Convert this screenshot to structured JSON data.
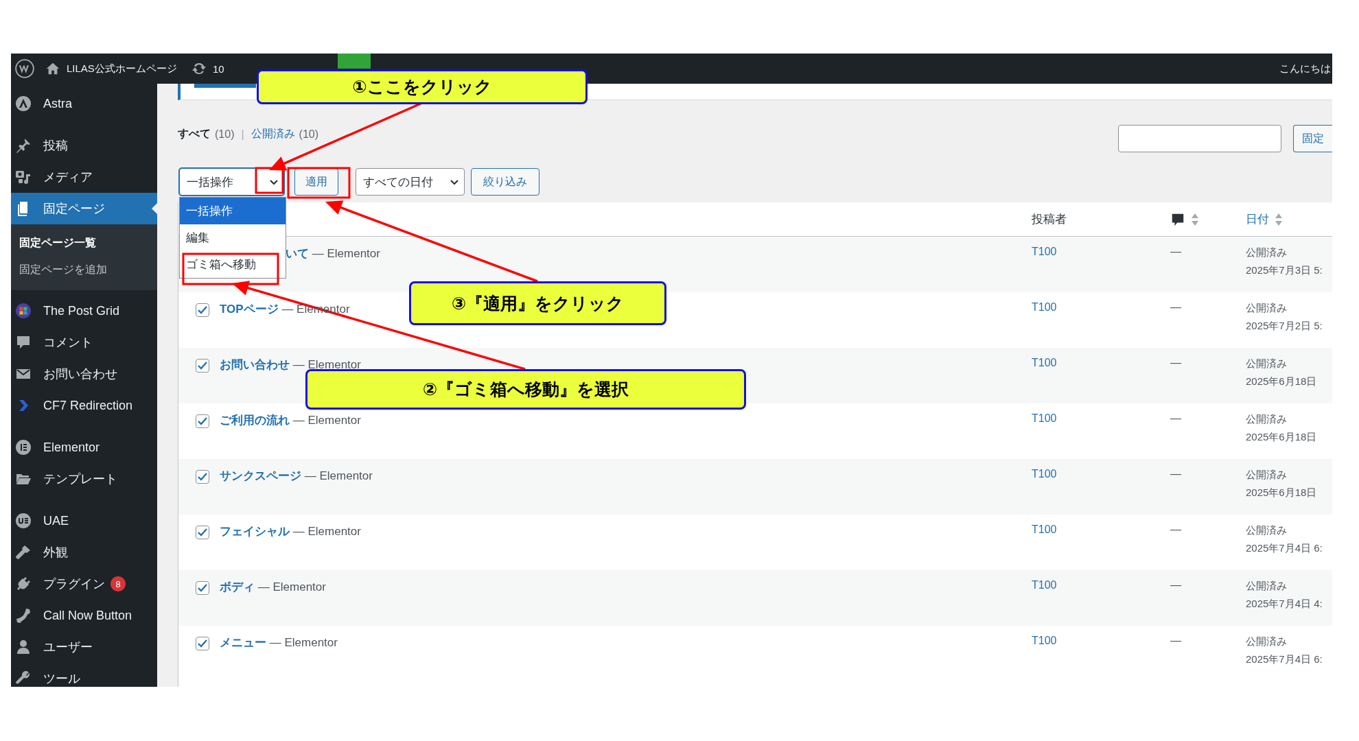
{
  "admin_bar": {
    "site_name": "LILAS公式ホームページ",
    "updates": "10",
    "greeting": "こんにちは"
  },
  "sidebar": {
    "groups": [
      [
        {
          "label": "Astra",
          "kind": "astra",
          "selected": false
        }
      ],
      [
        {
          "label": "投稿",
          "kind": "pin",
          "selected": false
        },
        {
          "label": "メディア",
          "kind": "media",
          "selected": false
        },
        {
          "label": "固定ページ",
          "kind": "pages",
          "selected": true,
          "children": [
            {
              "label": "固定ページ一覧",
              "selected": true
            },
            {
              "label": "固定ページを追加",
              "selected": false
            }
          ]
        },
        {
          "label": "The Post Grid",
          "kind": "grid",
          "selected": false
        },
        {
          "label": "コメント",
          "kind": "comment",
          "selected": false
        },
        {
          "label": "お問い合わせ",
          "kind": "mail",
          "selected": false
        },
        {
          "label": "CF7 Redirection",
          "kind": "chevron",
          "selected": false
        }
      ],
      [
        {
          "label": "Elementor",
          "kind": "elementor",
          "selected": false
        },
        {
          "label": "テンプレート",
          "kind": "folder",
          "selected": false
        }
      ],
      [
        {
          "label": "UAE",
          "kind": "uae",
          "selected": false
        },
        {
          "label": "外観",
          "kind": "brush",
          "selected": false
        },
        {
          "label": "プラグイン",
          "kind": "plug",
          "selected": false,
          "badge": "8"
        },
        {
          "label": "Call Now Button",
          "kind": "phone",
          "selected": false
        },
        {
          "label": "ユーザー",
          "kind": "user",
          "selected": false
        },
        {
          "label": "ツール",
          "kind": "wrench",
          "selected": false
        }
      ]
    ]
  },
  "views": {
    "separator": "|",
    "items": [
      {
        "label": "すべて",
        "count": "(10)",
        "selected": true
      },
      {
        "label": "公開済み",
        "count": "(10)",
        "selected": false
      }
    ]
  },
  "search": {
    "button": "固定"
  },
  "bulk_actions": {
    "value": "一括操作",
    "expanded": true,
    "options": [
      {
        "label": "一括操作",
        "selected": true
      },
      {
        "label": "編集",
        "selected": false
      },
      {
        "label": "ゴミ箱へ移動",
        "selected": false
      }
    ]
  },
  "apply_button": "適用",
  "date_filter": "すべての日付",
  "filter_button": "絞り込み",
  "table": {
    "columns": [
      {
        "kind": "author",
        "label": "投稿者",
        "sortable": false
      },
      {
        "kind": "comments",
        "sortable": true
      },
      {
        "kind": "date",
        "label": "日付",
        "sortable": true
      }
    ],
    "rows": [
      {
        "title": "いて",
        "suffix": "— Elementor",
        "author": "T100",
        "comments": "—",
        "status": "公開済み",
        "date": "2025年7月3日 5:"
      },
      {
        "checked": true,
        "title": "TOPページ",
        "suffix": "— Elementor",
        "author": "T100",
        "comments": "—",
        "status": "公開済み",
        "date": "2025年7月2日 5:"
      },
      {
        "checked": true,
        "title": "お問い合わせ",
        "suffix": "— Elementor",
        "author": "T100",
        "comments": "—",
        "status": "公開済み",
        "date": "2025年6月18日"
      },
      {
        "checked": true,
        "title": "ご利用の流れ",
        "suffix": "— Elementor",
        "author": "T100",
        "comments": "—",
        "status": "公開済み",
        "date": "2025年6月18日"
      },
      {
        "checked": true,
        "title": "サンクスページ",
        "suffix": "— Elementor",
        "author": "T100",
        "comments": "—",
        "status": "公開済み",
        "date": "2025年6月18日"
      },
      {
        "checked": true,
        "title": "フェイシャル",
        "suffix": "— Elementor",
        "author": "T100",
        "comments": "—",
        "status": "公開済み",
        "date": "2025年7月4日 6:"
      },
      {
        "checked": true,
        "title": "ボディ",
        "suffix": "— Elementor",
        "author": "T100",
        "comments": "—",
        "status": "公開済み",
        "date": "2025年7月4日 4:"
      },
      {
        "checked": true,
        "title": "メニュー",
        "suffix": "— Elementor",
        "author": "T100",
        "comments": "—",
        "status": "公開済み",
        "date": "2025年7月4日 6:"
      }
    ]
  },
  "annotations": {
    "callouts": [
      {
        "text": "①ここをクリック"
      },
      {
        "text": "③『適用』をクリック"
      },
      {
        "text": "②『ゴミ箱へ移動』を選択"
      }
    ]
  }
}
